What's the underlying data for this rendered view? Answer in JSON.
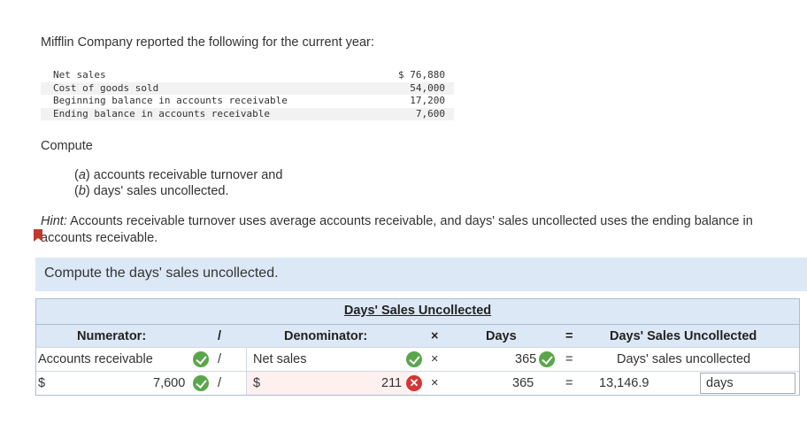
{
  "intro": "Mifflin Company reported the following for the current year:",
  "data_table": [
    {
      "label": "Net sales",
      "value": "$ 76,880"
    },
    {
      "label": "Cost of goods sold",
      "value": "54,000"
    },
    {
      "label": "Beginning balance in accounts receivable",
      "value": "17,200"
    },
    {
      "label": "Ending balance in accounts receivable",
      "value": "7,600"
    }
  ],
  "compute_label": "Compute",
  "items": [
    {
      "letter": "a",
      "text": "accounts receivable turnover and"
    },
    {
      "letter": "b",
      "text": "days' sales uncollected."
    }
  ],
  "hint": {
    "prefix": "Hint:",
    "text": "Accounts receivable turnover uses average accounts receivable, and days' sales uncollected uses the ending balance in accounts receivable."
  },
  "banner": "Compute the days' sales uncollected.",
  "grid": {
    "caption": "Days' Sales Uncollected",
    "headers": {
      "numerator": "Numerator:",
      "div": "/",
      "denominator": "Denominator:",
      "times": "×",
      "days": "Days",
      "eq": "=",
      "result": "Days' Sales Uncollected"
    },
    "row1": {
      "numerator": "Accounts receivable",
      "div": "/",
      "denominator": "Net sales",
      "times": "×",
      "days": "365",
      "eq": "=",
      "result": "Days' sales uncollected"
    },
    "row2": {
      "num_currency": "$",
      "numerator": "7,600",
      "div": "/",
      "den_currency": "$",
      "denominator": "211",
      "times": "×",
      "days": "365",
      "eq": "=",
      "result": "13,146.9",
      "unit": "days"
    }
  },
  "colors": {
    "banner": "#dce8f5",
    "correct": "#5aa64a",
    "incorrect": "#d43535",
    "error_fill": "#fff0f0"
  },
  "icons": {
    "correct": "check-circle-icon",
    "incorrect": "x-circle-icon",
    "bookmark": "bookmark-icon"
  }
}
